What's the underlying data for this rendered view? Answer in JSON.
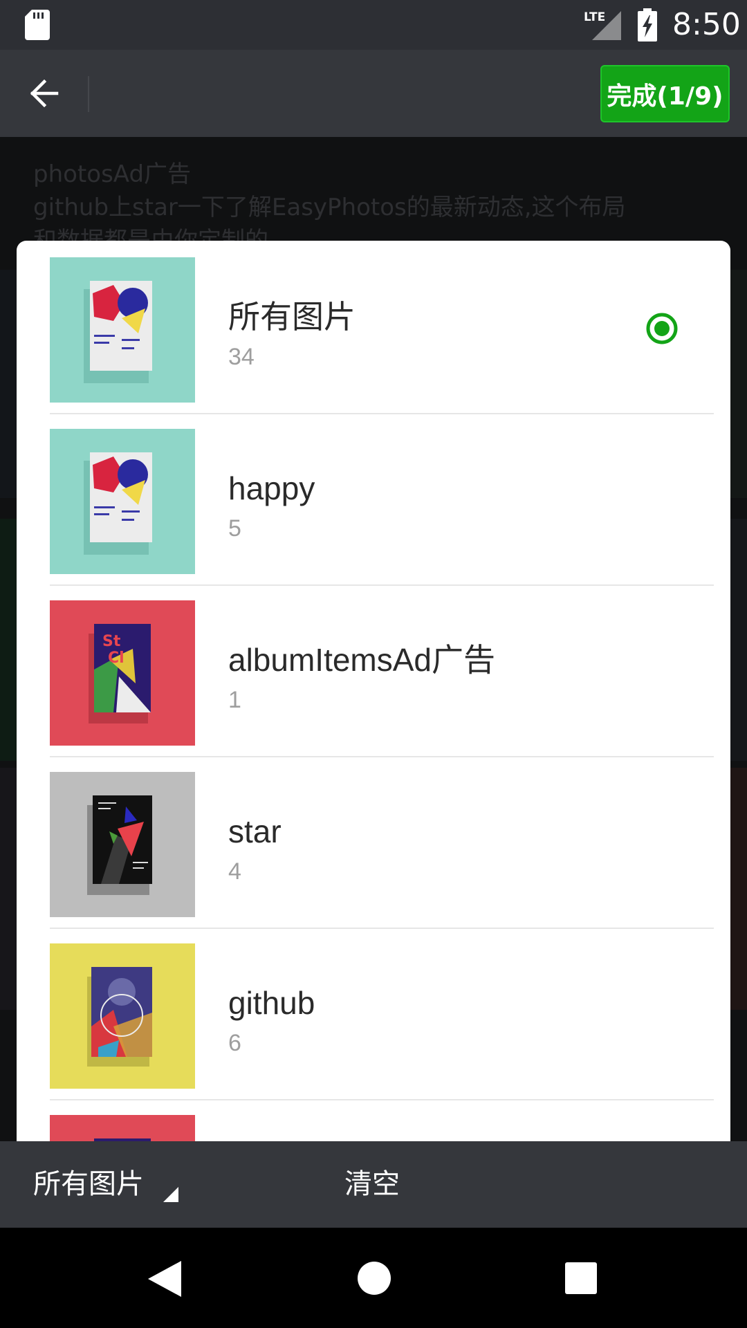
{
  "status_bar": {
    "time": "8:50",
    "network": "LTE",
    "icons": [
      "sd-card-icon",
      "lte-signal-icon",
      "battery-charging-icon"
    ]
  },
  "toolbar": {
    "back_icon": "arrow-left-icon",
    "done_label": "完成(1/9)",
    "accent_color": "#13a417"
  },
  "background_ad": {
    "line1": "photosAd广告",
    "line2": "github上star一下了解EasyPhotos的最新动态,这个布局",
    "line3": "和数据都是由你定制的"
  },
  "albums": [
    {
      "name": "所有图片",
      "count": "34",
      "selected": true
    },
    {
      "name": "happy",
      "count": "5",
      "selected": false
    },
    {
      "name": "albumItemsAd广告",
      "count": "1",
      "selected": false
    },
    {
      "name": "star",
      "count": "4",
      "selected": false
    },
    {
      "name": "github",
      "count": "6",
      "selected": false
    }
  ],
  "bottom_bar": {
    "album_selector_label": "所有图片",
    "clear_label": "清空"
  },
  "nav_bar": {
    "icons": [
      "nav-back-icon",
      "nav-home-icon",
      "nav-recents-icon"
    ]
  }
}
